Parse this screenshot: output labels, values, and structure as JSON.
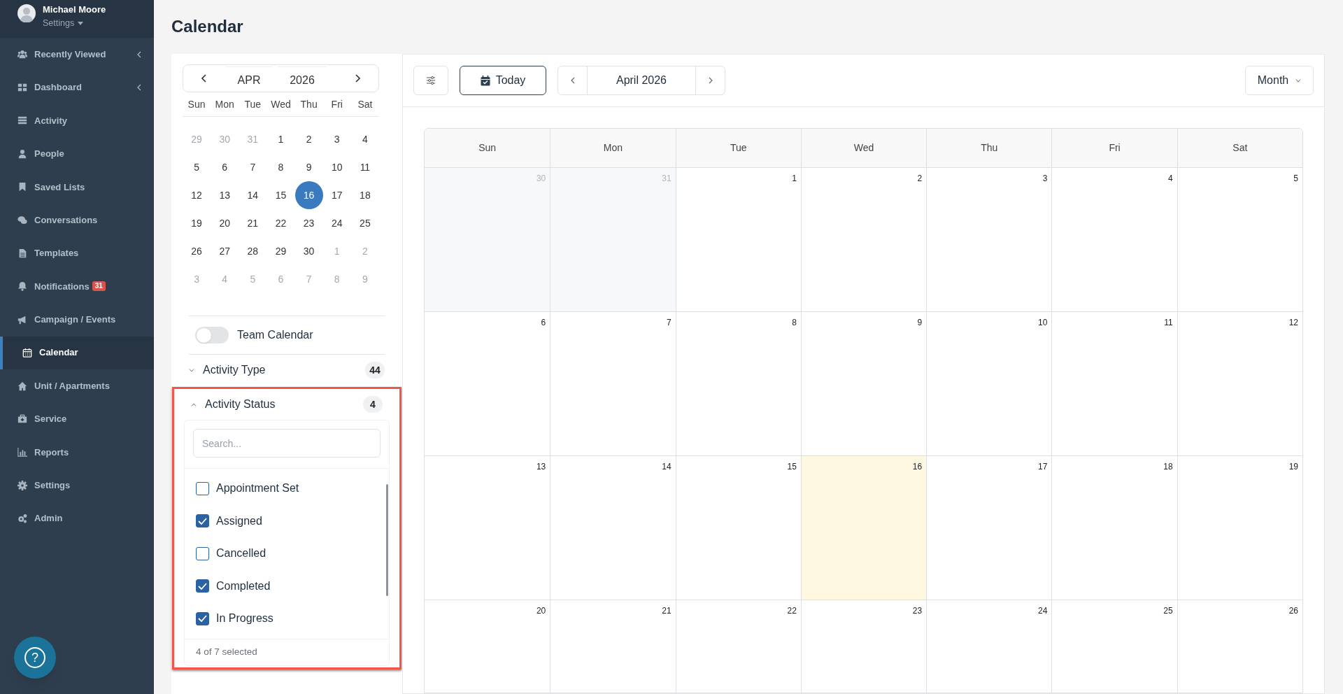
{
  "sidebar": {
    "user": {
      "name": "Michael Moore",
      "menu": "Settings"
    },
    "items": [
      {
        "label": "Recently Viewed",
        "selected": false,
        "expandable": true
      },
      {
        "label": "Dashboard",
        "selected": false,
        "expandable": true
      },
      {
        "label": "Activity",
        "selected": false,
        "expandable": false
      },
      {
        "label": "People",
        "selected": false,
        "expandable": false
      },
      {
        "label": "Saved Lists",
        "selected": false,
        "expandable": false
      },
      {
        "label": "Conversations",
        "selected": false,
        "expandable": false
      },
      {
        "label": "Templates",
        "selected": false,
        "expandable": false
      },
      {
        "label": "Notifications",
        "selected": false,
        "expandable": false,
        "badge": "31"
      },
      {
        "label": "Campaign / Events",
        "selected": false,
        "expandable": false
      },
      {
        "label": "Calendar",
        "selected": true,
        "expandable": false
      },
      {
        "label": "Unit / Apartments",
        "selected": false,
        "expandable": false
      },
      {
        "label": "Service",
        "selected": false,
        "expandable": false
      },
      {
        "label": "Reports",
        "selected": false,
        "expandable": false
      },
      {
        "label": "Settings",
        "selected": false,
        "expandable": false
      },
      {
        "label": "Admin",
        "selected": false,
        "expandable": false
      }
    ],
    "help": "?"
  },
  "page_title": "Calendar",
  "mini_calendar": {
    "month": "APR",
    "year": "2026",
    "weekdays": [
      "Sun",
      "Mon",
      "Tue",
      "Wed",
      "Thu",
      "Fri",
      "Sat"
    ],
    "weeks": [
      [
        {
          "day": "29",
          "muted": true,
          "selected": false
        },
        {
          "day": "30",
          "muted": true,
          "selected": false
        },
        {
          "day": "31",
          "muted": true,
          "selected": false
        },
        {
          "day": "1",
          "muted": false,
          "selected": false
        },
        {
          "day": "2",
          "muted": false,
          "selected": false
        },
        {
          "day": "3",
          "muted": false,
          "selected": false
        },
        {
          "day": "4",
          "muted": false,
          "selected": false
        }
      ],
      [
        {
          "day": "5",
          "muted": false,
          "selected": false
        },
        {
          "day": "6",
          "muted": false,
          "selected": false
        },
        {
          "day": "7",
          "muted": false,
          "selected": false
        },
        {
          "day": "8",
          "muted": false,
          "selected": false
        },
        {
          "day": "9",
          "muted": false,
          "selected": false
        },
        {
          "day": "10",
          "muted": false,
          "selected": false
        },
        {
          "day": "11",
          "muted": false,
          "selected": false
        }
      ],
      [
        {
          "day": "12",
          "muted": false,
          "selected": false
        },
        {
          "day": "13",
          "muted": false,
          "selected": false
        },
        {
          "day": "14",
          "muted": false,
          "selected": false
        },
        {
          "day": "15",
          "muted": false,
          "selected": false
        },
        {
          "day": "16",
          "muted": false,
          "selected": true
        },
        {
          "day": "17",
          "muted": false,
          "selected": false
        },
        {
          "day": "18",
          "muted": false,
          "selected": false
        }
      ],
      [
        {
          "day": "19",
          "muted": false,
          "selected": false
        },
        {
          "day": "20",
          "muted": false,
          "selected": false
        },
        {
          "day": "21",
          "muted": false,
          "selected": false
        },
        {
          "day": "22",
          "muted": false,
          "selected": false
        },
        {
          "day": "23",
          "muted": false,
          "selected": false
        },
        {
          "day": "24",
          "muted": false,
          "selected": false
        },
        {
          "day": "25",
          "muted": false,
          "selected": false
        }
      ],
      [
        {
          "day": "26",
          "muted": false,
          "selected": false
        },
        {
          "day": "27",
          "muted": false,
          "selected": false
        },
        {
          "day": "28",
          "muted": false,
          "selected": false
        },
        {
          "day": "29",
          "muted": false,
          "selected": false
        },
        {
          "day": "30",
          "muted": false,
          "selected": false
        },
        {
          "day": "1",
          "muted": true,
          "selected": false
        },
        {
          "day": "2",
          "muted": true,
          "selected": false
        }
      ],
      [
        {
          "day": "3",
          "muted": true,
          "selected": false
        },
        {
          "day": "4",
          "muted": true,
          "selected": false
        },
        {
          "day": "5",
          "muted": true,
          "selected": false
        },
        {
          "day": "6",
          "muted": true,
          "selected": false
        },
        {
          "day": "7",
          "muted": true,
          "selected": false
        },
        {
          "day": "8",
          "muted": true,
          "selected": false
        },
        {
          "day": "9",
          "muted": true,
          "selected": false
        }
      ]
    ]
  },
  "team_calendar": {
    "label": "Team Calendar",
    "on": false
  },
  "filters": [
    {
      "label": "Activity Type",
      "count": "44",
      "expanded": false,
      "highlighted": false
    },
    {
      "label": "Activity Status",
      "count": "4",
      "expanded": true,
      "highlighted": true,
      "search": {
        "placeholder": "Search..."
      },
      "options": [
        {
          "label": "Appointment Set",
          "checked": false
        },
        {
          "label": "Assigned",
          "checked": true
        },
        {
          "label": "Cancelled",
          "checked": false
        },
        {
          "label": "Completed",
          "checked": true
        },
        {
          "label": "In Progress",
          "checked": true
        }
      ],
      "footer": "4 of 7 selected"
    }
  ],
  "toolbar": {
    "today": "Today",
    "period": "April 2026",
    "view": "Month"
  },
  "month_grid": {
    "weekdays": [
      "Sun",
      "Mon",
      "Tue",
      "Wed",
      "Thu",
      "Fri",
      "Sat"
    ],
    "weeks": [
      [
        {
          "day": "30",
          "muted": true,
          "today": false
        },
        {
          "day": "31",
          "muted": true,
          "today": false
        },
        {
          "day": "1",
          "muted": false,
          "today": false
        },
        {
          "day": "2",
          "muted": false,
          "today": false
        },
        {
          "day": "3",
          "muted": false,
          "today": false
        },
        {
          "day": "4",
          "muted": false,
          "today": false
        },
        {
          "day": "5",
          "muted": false,
          "today": false
        }
      ],
      [
        {
          "day": "6",
          "muted": false,
          "today": false
        },
        {
          "day": "7",
          "muted": false,
          "today": false
        },
        {
          "day": "8",
          "muted": false,
          "today": false
        },
        {
          "day": "9",
          "muted": false,
          "today": false
        },
        {
          "day": "10",
          "muted": false,
          "today": false
        },
        {
          "day": "11",
          "muted": false,
          "today": false
        },
        {
          "day": "12",
          "muted": false,
          "today": false
        }
      ],
      [
        {
          "day": "13",
          "muted": false,
          "today": false
        },
        {
          "day": "14",
          "muted": false,
          "today": false
        },
        {
          "day": "15",
          "muted": false,
          "today": false
        },
        {
          "day": "16",
          "muted": false,
          "today": true
        },
        {
          "day": "17",
          "muted": false,
          "today": false
        },
        {
          "day": "18",
          "muted": false,
          "today": false
        },
        {
          "day": "19",
          "muted": false,
          "today": false
        }
      ],
      [
        {
          "day": "20",
          "muted": false,
          "today": false
        },
        {
          "day": "21",
          "muted": false,
          "today": false
        },
        {
          "day": "22",
          "muted": false,
          "today": false
        },
        {
          "day": "23",
          "muted": false,
          "today": false
        },
        {
          "day": "24",
          "muted": false,
          "today": false
        },
        {
          "day": "25",
          "muted": false,
          "today": false
        },
        {
          "day": "26",
          "muted": false,
          "today": false
        }
      ]
    ]
  }
}
